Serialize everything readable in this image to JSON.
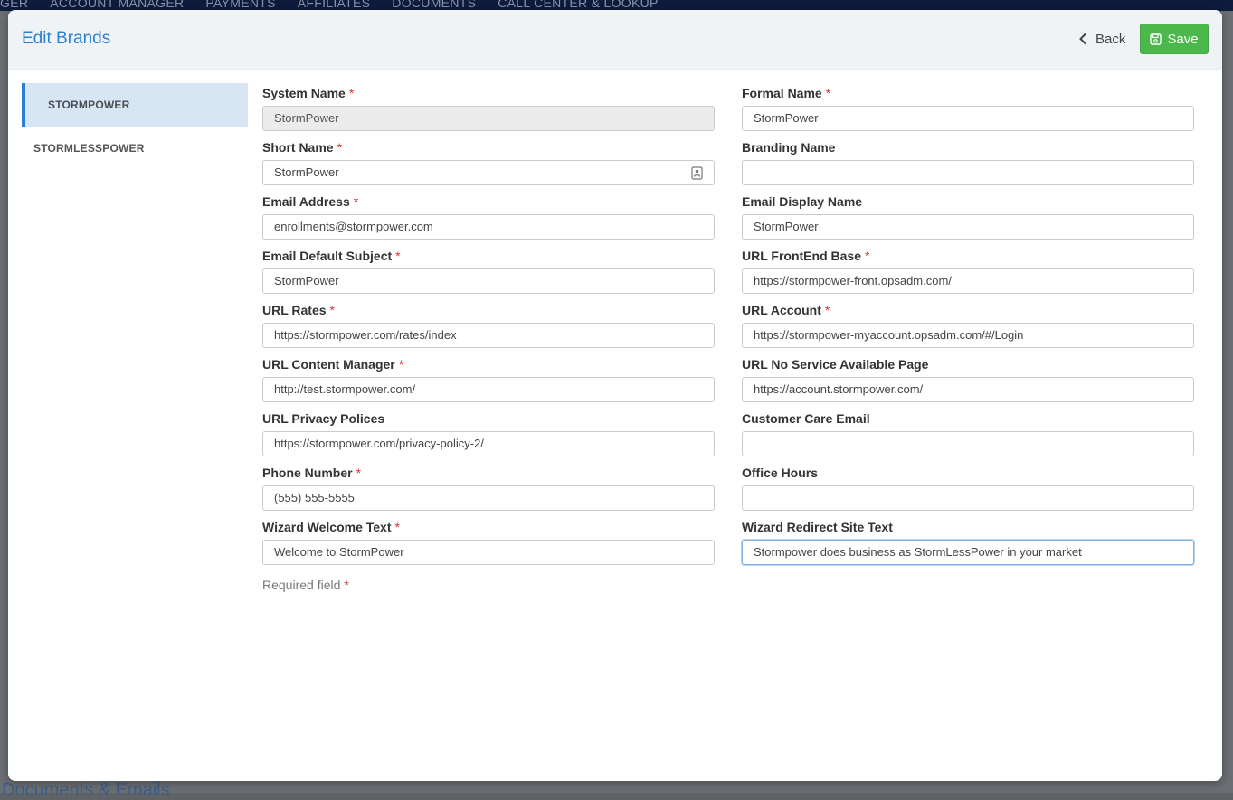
{
  "background": {
    "nav_items": [
      "GER",
      "ACCOUNT MANAGER",
      "PAYMENTS",
      "AFFILIATES",
      "DOCUMENTS",
      "CALL CENTER & LOOKUP"
    ],
    "bottom_text": "Documents & Emails"
  },
  "modal": {
    "title": "Edit Brands",
    "back_label": "Back",
    "save_label": "Save"
  },
  "sidebar": {
    "items": [
      {
        "label": "STORMPOWER",
        "active": true
      },
      {
        "label": "STORMLESSPOWER",
        "active": false
      }
    ]
  },
  "form": {
    "left": [
      {
        "label": "System Name",
        "required": true,
        "value": "StormPower",
        "disabled": true
      },
      {
        "label": "Short Name",
        "required": true,
        "value": "StormPower"
      },
      {
        "label": "Email Address",
        "required": true,
        "value": "enrollments@stormpower.com"
      },
      {
        "label": "Email Default Subject",
        "required": true,
        "value": "StormPower"
      },
      {
        "label": "URL Rates",
        "required": true,
        "value": "https://stormpower.com/rates/index"
      },
      {
        "label": "URL Content Manager",
        "required": true,
        "value": "http://test.stormpower.com/"
      },
      {
        "label": "URL Privacy Polices",
        "required": false,
        "value": "https://stormpower.com/privacy-policy-2/"
      },
      {
        "label": "Phone Number",
        "required": true,
        "value": "(555) 555-5555"
      },
      {
        "label": "Wizard Welcome Text",
        "required": true,
        "value": "Welcome to StormPower"
      }
    ],
    "right": [
      {
        "label": "Formal Name",
        "required": true,
        "value": "StormPower"
      },
      {
        "label": "Branding Name",
        "required": false,
        "value": ""
      },
      {
        "label": "Email Display Name",
        "required": false,
        "value": "StormPower"
      },
      {
        "label": "URL FrontEnd Base",
        "required": true,
        "value": "https://stormpower-front.opsadm.com/"
      },
      {
        "label": "URL Account",
        "required": true,
        "value": "https://stormpower-myaccount.opsadm.com/#/Login"
      },
      {
        "label": "URL No Service Available Page",
        "required": false,
        "value": "https://account.stormpower.com/"
      },
      {
        "label": "Customer Care Email",
        "required": false,
        "value": ""
      },
      {
        "label": "Office Hours",
        "required": false,
        "value": ""
      },
      {
        "label": "Wizard Redirect Site Text",
        "required": false,
        "value": "Stormpower does business as StormLessPower in your market",
        "focused": true
      }
    ],
    "required_note": "Required field",
    "required_mark": "*"
  },
  "colors": {
    "accent": "#2b7fd1",
    "save_green": "#4cb74b",
    "required_red": "#d33333"
  }
}
